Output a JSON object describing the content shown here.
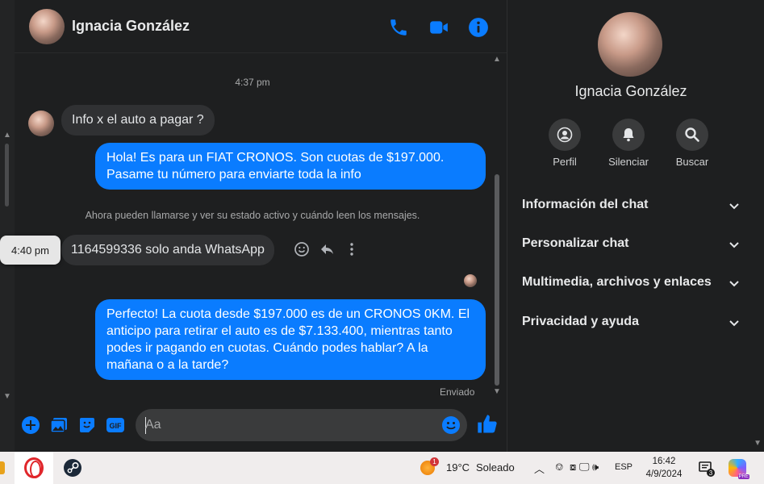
{
  "chat": {
    "contact_name": "Ignacia González",
    "time_separator": "4:37 pm",
    "messages": [
      {
        "direction": "in",
        "text": "Info x el auto a pagar ?"
      },
      {
        "direction": "out",
        "text": "Hola! Es para un FIAT CRONOS. Son cuotas de $197.000. Pasame tu número para enviarte toda la info"
      },
      {
        "direction": "in",
        "text": "1164599336 solo anda WhatsApp"
      },
      {
        "direction": "out",
        "text": "Perfecto! La cuota desde $197.000 es de un CRONOS 0KM. El anticipo para retirar el auto es de $7.133.400, mientras tanto podes ir pagando en cuotas. Cuándo podes hablar? A la mañana o a la tarde?"
      }
    ],
    "notice": "Ahora pueden llamarse y ver su estado activo y cuándo leen los mensajes.",
    "hover_time": "4:40 pm",
    "sent_status": "Enviado",
    "composer_placeholder": "Aa",
    "accent_color": "#0a7cff"
  },
  "panel": {
    "name": "Ignacia González",
    "actions": [
      {
        "label": "Perfil",
        "icon": "profile-icon"
      },
      {
        "label": "Silenciar",
        "icon": "bell-icon"
      },
      {
        "label": "Buscar",
        "icon": "search-icon"
      }
    ],
    "sections": [
      "Información del chat",
      "Personalizar chat",
      "Multimedia, archivos y enlaces",
      "Privacidad y ayuda"
    ]
  },
  "taskbar": {
    "weather_badge": "1",
    "temperature": "19°C",
    "condition": "Soleado",
    "language": "ESP",
    "time": "16:42",
    "date": "4/9/2024",
    "notifications": "3",
    "copilot_badge": "PRE"
  }
}
